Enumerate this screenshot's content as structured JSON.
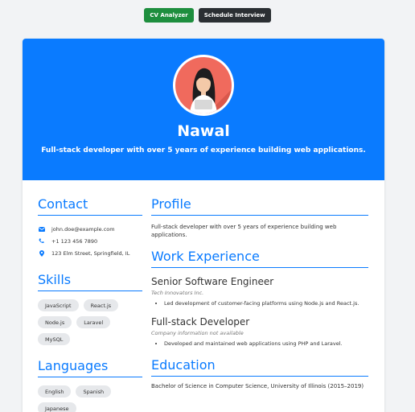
{
  "topbar": {
    "cv_analyzer": "CV Analyzer",
    "schedule_interview": "Schedule Interview"
  },
  "header": {
    "name": "Nawal",
    "tagline": "Full-stack developer with over 5 years of experience building web applications."
  },
  "contact": {
    "title": "Contact",
    "email": "john.doe@example.com",
    "phone": "+1 123 456 7890",
    "address": "123 Elm Street, Springfield, IL"
  },
  "skills": {
    "title": "Skills",
    "items": [
      "JavaScript",
      "React.js",
      "Node.js",
      "Laravel",
      "MySQL"
    ]
  },
  "languages": {
    "title": "Languages",
    "items": [
      "English",
      "Spanish",
      "Japanese"
    ]
  },
  "profile": {
    "title": "Profile",
    "text": "Full-stack developer with over 5 years of experience building web applications."
  },
  "experience": {
    "title": "Work Experience",
    "jobs": [
      {
        "title": "Senior Software Engineer",
        "company": "Tech Innovators Inc.",
        "bullets": [
          "Led development of customer-facing platforms using Node.js and React.js."
        ]
      },
      {
        "title": "Full-stack Developer",
        "company": "Company information not available",
        "bullets": [
          "Developed and maintained web applications using PHP and Laravel."
        ]
      }
    ]
  },
  "education": {
    "title": "Education",
    "text": "Bachelor of Science in Computer Science, University of Illinois (2015–2019)"
  },
  "colors": {
    "accent": "#0a7bff",
    "green": "#1e8e3e",
    "dark": "#2b2f33"
  }
}
